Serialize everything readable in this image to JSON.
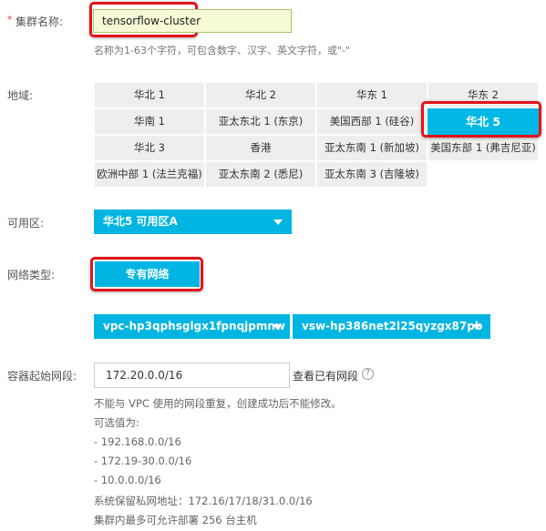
{
  "cluster_name": {
    "label": "集群名称:",
    "value": "tensorflow-cluster",
    "hint": "名称为1-63个字符，可包含数字、汉字、英文字符，或\"-\""
  },
  "region": {
    "label": "地域:",
    "options": [
      [
        "华北 1",
        "华北 2",
        "华东 1",
        "华东 2"
      ],
      [
        "华南 1",
        "亚太东北 1 (东京)",
        "美国西部 1 (硅谷)",
        "华北 5"
      ],
      [
        "华北 3",
        "香港",
        "亚太东南 1 (新加坡)",
        "美国东部 1 (弗吉尼亚)"
      ],
      [
        "欧洲中部 1 (法兰克福)",
        "亚太东南 2 (悉尼)",
        "亚太东南 3 (吉隆坡)"
      ]
    ],
    "selected": "华北 5"
  },
  "zone": {
    "label": "可用区:",
    "value": "华北5 可用区A"
  },
  "network": {
    "label": "网络类型:",
    "value": "专有网络",
    "vpc": "vpc-hp3qphsglgx1fpnqjpmnw",
    "vswitch": "vsw-hp386net2l25qyzgx87pb"
  },
  "cidr": {
    "label": "容器起始网段:",
    "value": "172.20.0.0/16",
    "view_link": "查看已有网段",
    "help": "?",
    "notes": [
      "不能与 VPC 使用的网段重复，创建成功后不能修改。",
      "可选值为:",
      "- 192.168.0.0/16",
      "- 172.19-30.0.0/16",
      "- 10.0.0.0/16",
      "系统保留私网地址：172.16/17/18/31.0.0/16",
      "集群内最多可允许部署 256 台主机"
    ]
  },
  "required_mark": "*",
  "colors": {
    "accent": "#00b5e2",
    "highlight": "#e0141b",
    "input_bg": "#f7fbd5"
  }
}
